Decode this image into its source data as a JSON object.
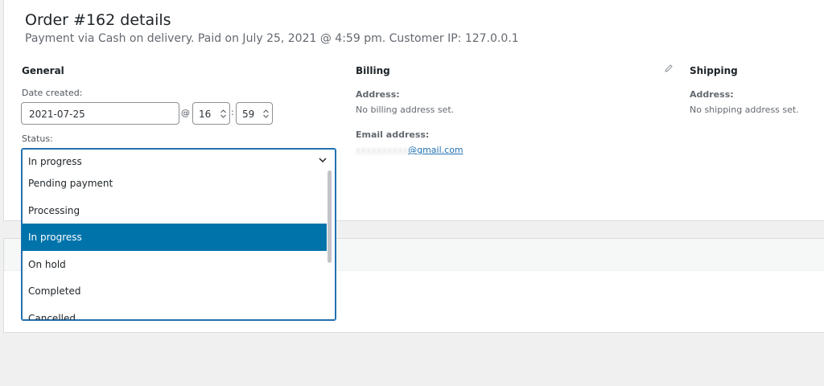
{
  "header": {
    "title": "Order #162 details",
    "subtitle": "Payment via Cash on delivery. Paid on July 25, 2021 @ 4:59 pm. Customer IP: 127.0.0.1"
  },
  "general": {
    "heading": "General",
    "date_label": "Date created:",
    "date_value": "2021-07-25",
    "at_sep": "@",
    "hour_value": "16",
    "colon_sep": ":",
    "minute_value": "59",
    "status_label": "Status:",
    "status_value": "In progress",
    "status_options": [
      "Pending payment",
      "Processing",
      "In progress",
      "On hold",
      "Completed",
      "Cancelled"
    ],
    "selected_index": 2
  },
  "billing": {
    "heading": "Billing",
    "address_label": "Address:",
    "address_value": "No billing address set.",
    "email_label": "Email address:",
    "email_visible": "@gmail.com"
  },
  "shipping": {
    "heading": "Shipping",
    "address_label": "Address:",
    "address_value": "No shipping address set."
  },
  "icons": {
    "edit": "pencil-icon",
    "dropdown": "chevron-down-icon",
    "spinner": "spin-arrows-icon"
  },
  "colors": {
    "accent": "#2271b1",
    "selected_option": "#0073aa"
  }
}
